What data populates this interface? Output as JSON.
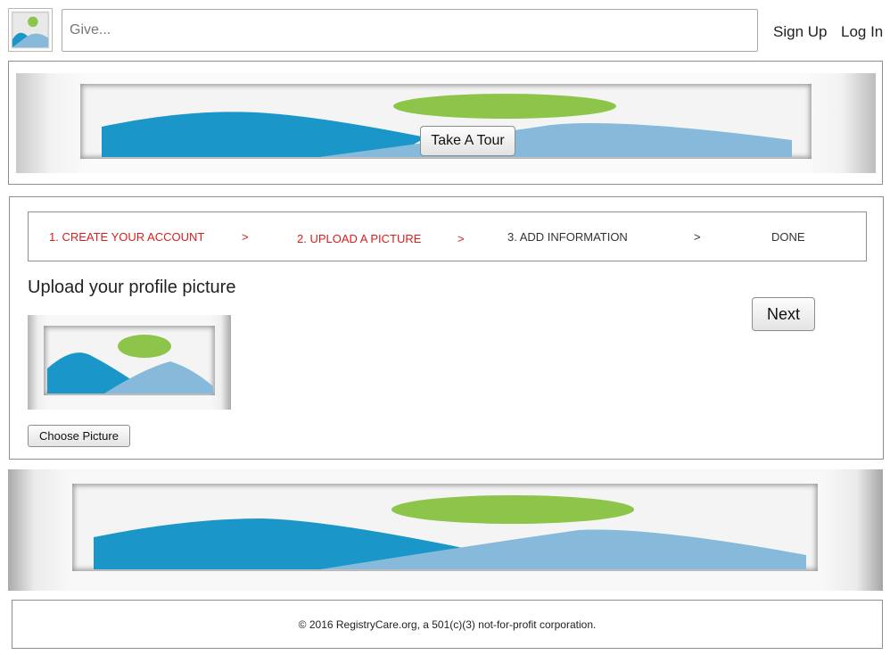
{
  "header": {
    "logo_icon": "image-placeholder-icon",
    "search": {
      "placeholder": "Give...",
      "value": ""
    },
    "signup_label": "Sign Up",
    "login_label": "Log In"
  },
  "hero": {
    "image_icon": "image-placeholder-icon",
    "tour_button_label": "Take A Tour"
  },
  "wizard": {
    "steps": [
      {
        "label": "1. CREATE YOUR ACCOUNT",
        "state": "completed"
      },
      {
        "label": "2. UPLOAD A PICTURE",
        "state": "current"
      },
      {
        "label": "3. ADD INFORMATION",
        "state": "pending"
      },
      {
        "label": "DONE",
        "state": "pending"
      }
    ],
    "separator": ">",
    "title": "Upload your profile picture",
    "next_button_label": "Next",
    "picture_placeholder_icon": "image-placeholder-icon",
    "choose_button_label": "Choose Picture"
  },
  "banner": {
    "image_icon": "image-placeholder-icon"
  },
  "footer": {
    "text": "© 2016 RegistryCare.org, a 501(c)(3) not-for-profit corporation."
  },
  "colors": {
    "step_active": "#d42020",
    "step_pending": "#333333",
    "mountain_dark": "#1a96c8",
    "mountain_light": "#86b9da",
    "sun": "#8dc44a"
  }
}
